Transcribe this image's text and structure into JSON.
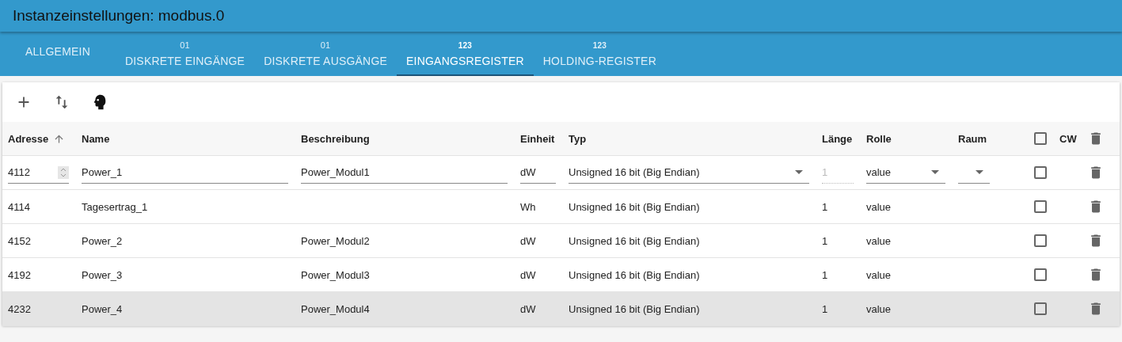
{
  "window": {
    "title": "Instanzeinstellungen: modbus.0"
  },
  "tabs": [
    {
      "label": "ALLGEMEIN",
      "kind": "plain",
      "selected": false
    },
    {
      "badge": "01",
      "kind": "bit",
      "label": "DISKRETE EINGÄNGE",
      "selected": false
    },
    {
      "badge": "01",
      "kind": "bit",
      "label": "DISKRETE AUSGÄNGE",
      "selected": false
    },
    {
      "badge": "123",
      "kind": "register",
      "label": "EINGANGSREGISTER",
      "selected": true
    },
    {
      "badge": "123",
      "kind": "register",
      "label": "HOLDING-REGISTER",
      "selected": false
    }
  ],
  "columns": [
    {
      "label": "Adresse",
      "sorted": true
    },
    {
      "label": "Name",
      "sorted": false
    },
    {
      "label": "Beschreibung",
      "sorted": false
    },
    {
      "label": "Einheit",
      "sorted": false
    },
    {
      "label": "Typ",
      "sorted": false
    },
    {
      "label": "Länge",
      "sorted": false
    },
    {
      "label": "Rolle",
      "sorted": false
    },
    {
      "label": "Raum",
      "sorted": false
    }
  ],
  "header_checkbox": {
    "checked": false
  },
  "cw_label": "CW",
  "rows": [
    {
      "kind": "edit",
      "selected": false,
      "address": "4112",
      "name": "Power_1",
      "description": "Power_Modul1",
      "unit": "dW",
      "type": "Unsigned 16 bit (Big Endian)",
      "length": "1",
      "role": "value",
      "checked": false
    },
    {
      "kind": "view",
      "selected": false,
      "address": "4114",
      "name": "Tagesertrag_1",
      "unit": "Wh",
      "type": "Unsigned 16 bit (Big Endian)",
      "length": "1",
      "role": "value",
      "checked": false
    },
    {
      "kind": "view",
      "selected": false,
      "address": "4152",
      "name": "Power_2",
      "description": "Power_Modul2",
      "unit": "dW",
      "type": "Unsigned 16 bit (Big Endian)",
      "length": "1",
      "role": "value",
      "checked": false
    },
    {
      "kind": "view",
      "selected": false,
      "address": "4192",
      "name": "Power_3",
      "description": "Power_Modul3",
      "unit": "dW",
      "type": "Unsigned 16 bit (Big Endian)",
      "length": "1",
      "role": "value",
      "checked": false
    },
    {
      "kind": "view",
      "selected": true,
      "address": "4232",
      "name": "Power_4",
      "description": "Power_Modul4",
      "unit": "dW",
      "type": "Unsigned 16 bit (Big Endian)",
      "length": "1",
      "role": "value",
      "checked": false
    }
  ]
}
